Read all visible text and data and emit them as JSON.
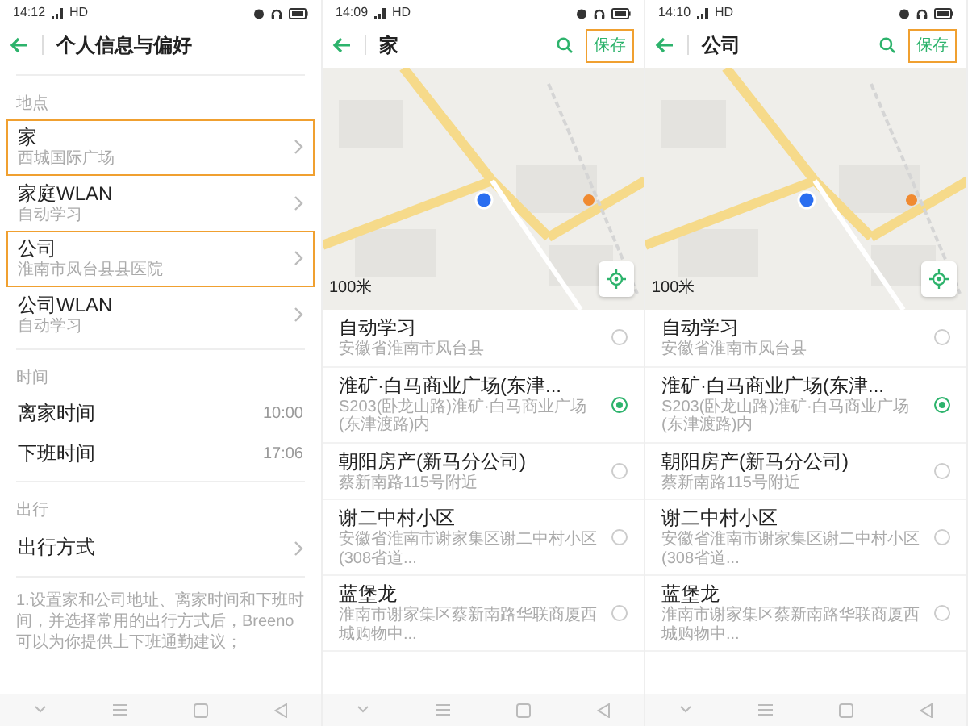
{
  "screens": [
    {
      "kind": "settings",
      "status_bar": {
        "time": "14:12",
        "network": "HD"
      },
      "title": "个人信息与偏好",
      "sections": [
        {
          "header": "地点",
          "items": [
            {
              "kind": "link",
              "label": "家",
              "detail": "西城国际广场",
              "highlighted": true
            },
            {
              "kind": "link",
              "label": "家庭WLAN",
              "detail": "自动学习",
              "highlighted": false
            },
            {
              "kind": "link",
              "label": "公司",
              "detail": "淮南市凤台县县医院",
              "highlighted": true
            },
            {
              "kind": "link",
              "label": "公司WLAN",
              "detail": "自动学习",
              "highlighted": false
            }
          ]
        },
        {
          "header": "时间",
          "items": [
            {
              "kind": "value",
              "label": "离家时间",
              "value": "10:00"
            },
            {
              "kind": "value",
              "label": "下班时间",
              "value": "17:06"
            }
          ]
        },
        {
          "header": "出行",
          "items": [
            {
              "kind": "link",
              "label": "出行方式",
              "highlighted": false
            }
          ]
        }
      ],
      "note": "1.设置家和公司地址、离家时间和下班时间，并选择常用的出行方式后，Breeno 可以为你提供上下班通勤建议；"
    },
    {
      "kind": "picker",
      "status_bar": {
        "time": "14:09",
        "network": "HD"
      },
      "title": "家",
      "save": {
        "label": "保存",
        "highlighted": true
      },
      "map": {
        "scale": "100米"
      },
      "places": [
        {
          "name": "自动学习",
          "address": "安徽省淮南市凤台县",
          "selected": false
        },
        {
          "name": "淮矿·白马商业广场(东津...",
          "address": "S203(卧龙山路)淮矿·白马商业广场(东津渡路)内",
          "selected": true
        },
        {
          "name": "朝阳房产(新马分公司)",
          "address": "蔡新南路115号附近",
          "selected": false
        },
        {
          "name": "谢二中村小区",
          "address": "安徽省淮南市谢家集区谢二中村小区(308省道...",
          "selected": false
        },
        {
          "name": "蓝堡龙",
          "address": "淮南市谢家集区蔡新南路华联商厦西城购物中...",
          "selected": false
        }
      ]
    },
    {
      "kind": "picker",
      "status_bar": {
        "time": "14:10",
        "network": "HD"
      },
      "title": "公司",
      "save": {
        "label": "保存",
        "highlighted": true
      },
      "map": {
        "scale": "100米"
      },
      "places": [
        {
          "name": "自动学习",
          "address": "安徽省淮南市凤台县",
          "selected": false
        },
        {
          "name": "淮矿·白马商业广场(东津...",
          "address": "S203(卧龙山路)淮矿·白马商业广场(东津渡路)内",
          "selected": true
        },
        {
          "name": "朝阳房产(新马分公司)",
          "address": "蔡新南路115号附近",
          "selected": false
        },
        {
          "name": "谢二中村小区",
          "address": "安徽省淮南市谢家集区谢二中村小区(308省道...",
          "selected": false
        },
        {
          "name": "蓝堡龙",
          "address": "淮南市谢家集区蔡新南路华联商厦西城购物中...",
          "selected": false
        }
      ]
    }
  ]
}
